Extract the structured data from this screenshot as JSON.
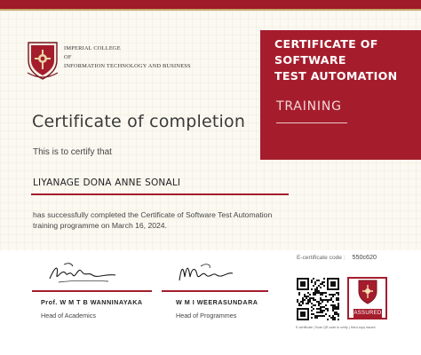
{
  "institution": {
    "name_lines": [
      "IMPERIAL COLLEGE",
      "OF",
      "INFORMATION TECHNOLOGY AND BUSINESS"
    ]
  },
  "certificate": {
    "title_lines": [
      "CERTIFICATE OF",
      "SOFTWARE",
      "TEST AUTOMATION"
    ],
    "subtitle": "TRAINING",
    "heading": "Certificate of completion",
    "certify_text": "This is to certify that",
    "recipient": "LIYANAGE DONA ANNE SONALI",
    "body_line1": "has successfully completed the Certificate of Software Test Automation",
    "body_line2": "training programme on March 16, 2024."
  },
  "ecertificate": {
    "label": "E-certificate code :",
    "code": "550c620"
  },
  "signatories": [
    {
      "name": "Prof. W M T B WANNINAYAKA",
      "role": "Head of Academics"
    },
    {
      "name": "W M I WEERASUNDARA",
      "role": "Head of Programmes"
    }
  ],
  "seal": {
    "label": "ASSURED"
  },
  "verify_note": "E-certificate | Scan QR code to verify | Hard copy issued",
  "colors": {
    "brand_red": "#a51d2d",
    "gold": "#c9a96a",
    "paper": "#fbf9f1"
  }
}
